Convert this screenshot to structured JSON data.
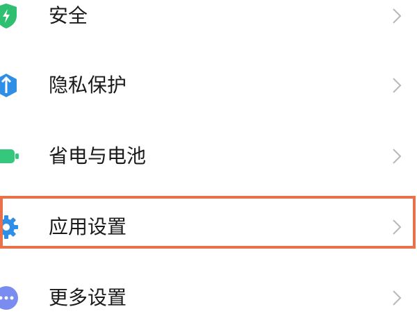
{
  "settings": {
    "items": [
      {
        "label": "安全",
        "icon": "security-shield-icon",
        "color": "#2fbf71"
      },
      {
        "label": "隐私保护",
        "icon": "privacy-icon",
        "color": "#2f8fe6"
      },
      {
        "label": "省电与电池",
        "icon": "battery-icon",
        "color": "#35c77b"
      },
      {
        "label": "应用设置",
        "icon": "gear-icon",
        "color": "#2f8fe6"
      },
      {
        "label": "更多设置",
        "icon": "more-dots-icon",
        "color": "#7b8cf0"
      }
    ],
    "highlighted_item": "应用设置",
    "highlight_color": "#e8704a"
  }
}
